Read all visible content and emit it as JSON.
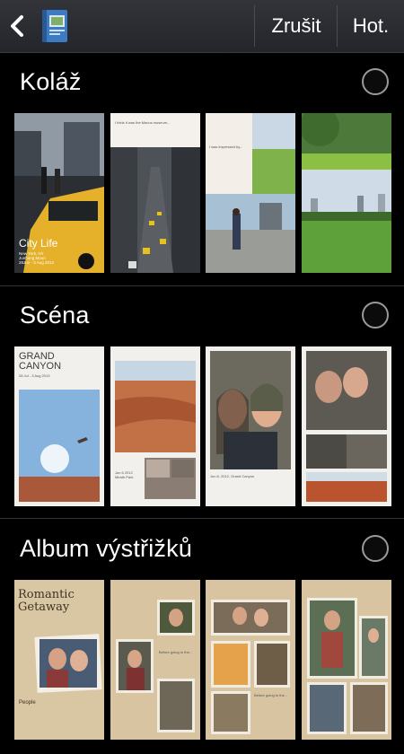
{
  "action_bar": {
    "back_icon": "back-arrow-icon",
    "app_icon": "album-book-icon",
    "cancel_label": "Zrušit",
    "done_label": "Hot."
  },
  "sections": [
    {
      "title": "Koláž",
      "thumbnails": [
        {
          "title": "City Life",
          "subtitle": "New York, NY\nJunbong Moon\n28Jun - 3 Aug 2012"
        },
        {
          "caption": "I think it was the Macos museum..."
        },
        {
          "caption": "I was impressed by..."
        },
        {
          "caption": ""
        }
      ]
    },
    {
      "title": "Scéna",
      "thumbnails": [
        {
          "title": "GRAND\nCANYON",
          "date": "28 Jul - 3 Aug 2013"
        },
        {
          "caption": "Jun 6 2012\nMirath Park"
        },
        {
          "caption": "Jun 8, 2012, Grand Canyon"
        },
        {
          "caption": ""
        }
      ]
    },
    {
      "title": "Album výstřižků",
      "thumbnails": [
        {
          "title": "Romantic\nGetaway",
          "footer": "People"
        },
        {
          "caption": "Before going to the..."
        },
        {
          "caption": "Before going to the..."
        },
        {
          "caption": ""
        }
      ]
    }
  ],
  "colors": {
    "background": "#000000",
    "action_bar": "#2b2c31",
    "radio_border": "#9a9a9a"
  }
}
